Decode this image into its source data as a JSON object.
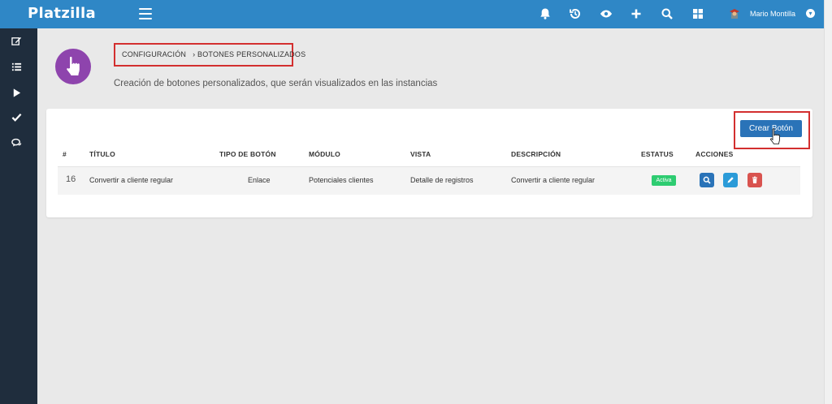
{
  "app": {
    "brand": "Platzilla"
  },
  "user": {
    "name": "Mario Montilla"
  },
  "topbar_icons": [
    "bell-icon",
    "history-icon",
    "eye-icon",
    "plus-icon",
    "search-icon",
    "grid-icon"
  ],
  "sidebar_icons": [
    "edit-icon",
    "list-icon",
    "play-icon",
    "check-icon",
    "chat-icon"
  ],
  "breadcrumb": {
    "item1": "CONFIGURACIÓN",
    "item2": "› BOTONES PERSONALIZADOS"
  },
  "page": {
    "subtitle": "Creación de botones personalizados, que serán visualizados en las instancias"
  },
  "toolbar": {
    "create_label": "Crear Botón"
  },
  "table": {
    "headers": [
      "#",
      "TÍTULO",
      "TIPO DE BOTÓN",
      "MÓDULO",
      "VISTA",
      "DESCRIPCIÓN",
      "ESTATUS",
      "ACCIONES"
    ],
    "rows": [
      {
        "id": "16",
        "title": "Convertir a cliente regular",
        "type": "Enlace",
        "module": "Potenciales clientes",
        "view": "Detalle de registros",
        "description": "Convertir a cliente regular",
        "status": "Activa"
      }
    ]
  },
  "colors": {
    "topbar": "#2f87c6",
    "sidebar": "#1f2d3d",
    "accent_purple": "#8e44ad",
    "status_green": "#2ecc71",
    "delete_red": "#d9534f",
    "edit_blue": "#2b9bd8",
    "view_blue": "#2a73b8"
  }
}
